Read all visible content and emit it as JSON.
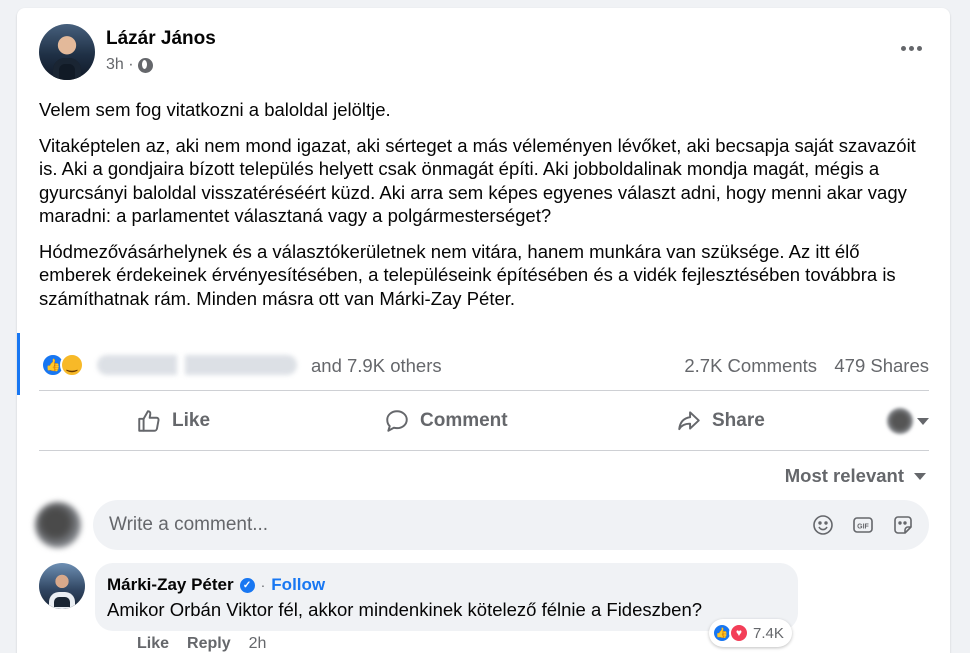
{
  "post": {
    "author": "Lázár János",
    "time": "3h ·",
    "paragraphs": [
      "Velem sem fog vitatkozni a baloldal jelöltje.",
      "Vitaképtelen az, aki nem mond igazat, aki sérteget a más véleményen lévőket, aki becsapja saját szavazóit is. Aki a gondjaira bízott település helyett csak önmagát építi. Aki jobboldalinak mondja magát, mégis a gyurcsányi baloldal visszatéréséért küzd. Aki arra sem képes egyenes választ adni, hogy menni akar vagy maradni: a parlamentet választaná vagy a polgármesterséget?",
      "Hódmezővásárhelynek és a választókerületnek nem vitára, hanem munkára van szüksége. Az itt élő emberek érdekeinek érvényesítésében, a településeink építésében és a vidék fejlesztésében továbbra is számíthatnak rám. Minden másra ott van Márki-Zay Péter."
    ]
  },
  "stats": {
    "reactors_blurred": "Pekul Ecsoi, David Long",
    "others": "and 7.9K others",
    "comments": "2.7K Comments",
    "shares": "479 Shares"
  },
  "actions": {
    "like": "Like",
    "comment": "Comment",
    "share": "Share"
  },
  "sort": {
    "label": "Most relevant"
  },
  "composer": {
    "placeholder": "Write a comment..."
  },
  "reply": {
    "name": "Márki-Zay Péter",
    "dot": "·",
    "follow": "Follow",
    "text": "Amikor Orbán Viktor fél, akkor mindenkinek kötelező félnie a Fideszben?",
    "like": "Like",
    "reply": "Reply",
    "time": "2h",
    "reactions": "7.4K"
  },
  "icons": {
    "globe": "globe-icon",
    "more": "more-options-icon",
    "like": "thumbs-up-icon",
    "comment": "speech-bubble-icon",
    "share": "share-arrow-icon",
    "emoji": "emoji-icon",
    "gif": "gif-icon",
    "sticker": "sticker-icon",
    "verified": "verified-badge-icon"
  },
  "colors": {
    "accent": "#1877f2",
    "secondary_text": "#65676b",
    "haha": "#f7b928",
    "love": "#f33e58"
  }
}
